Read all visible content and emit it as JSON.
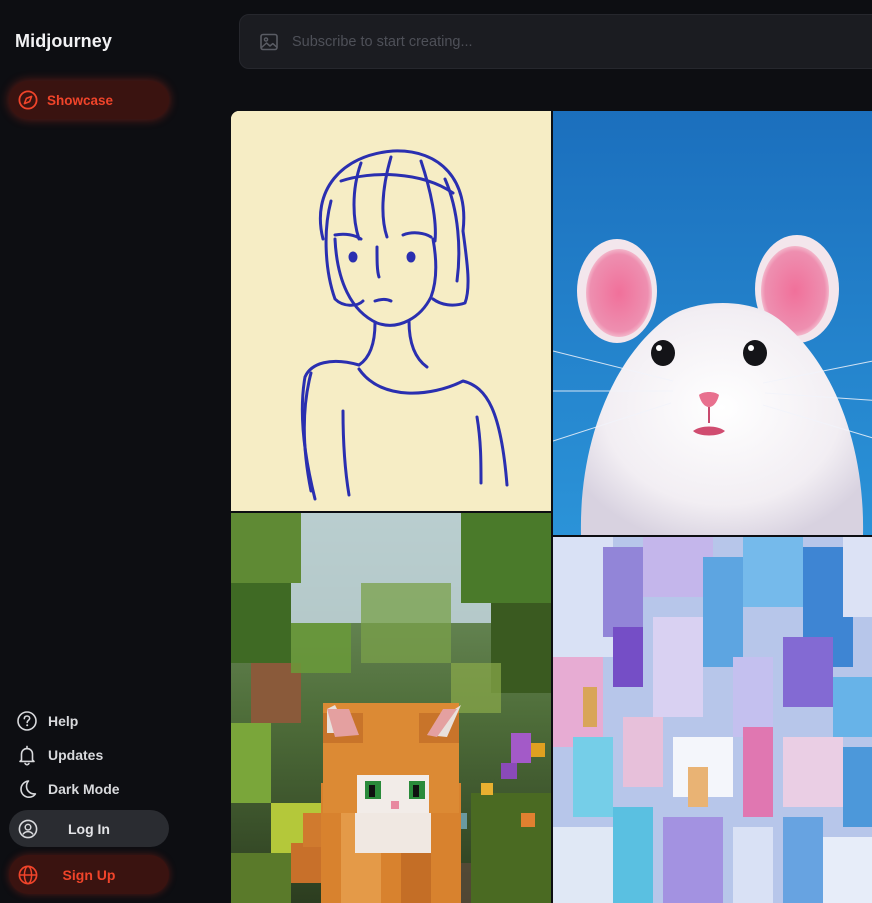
{
  "app": {
    "brand": "Midjourney"
  },
  "sidebar": {
    "primary_nav": [
      {
        "label": "Showcase",
        "icon": "compass-icon",
        "active": true
      }
    ],
    "links": [
      {
        "label": "Help",
        "icon": "help-circle-icon"
      },
      {
        "label": "Updates",
        "icon": "bell-icon"
      },
      {
        "label": "Dark Mode",
        "icon": "moon-icon"
      }
    ],
    "login_label": "Log In",
    "signup_label": "Sign Up"
  },
  "search": {
    "placeholder": "Subscribe to start creating...",
    "icon": "image-icon"
  },
  "gallery": {
    "images": [
      {
        "subject": "blue ink sketch of a girl"
      },
      {
        "subject": "white mouse with pink ears"
      },
      {
        "subject": "voxel orange cat in garden"
      },
      {
        "subject": "abstract pastel brush strokes"
      }
    ]
  },
  "colors": {
    "background": "#0d0e12",
    "accent": "#f0442a",
    "accent_bg": "#3a1310",
    "panel": "#1b1c21",
    "button_dark": "#2a2c31"
  }
}
